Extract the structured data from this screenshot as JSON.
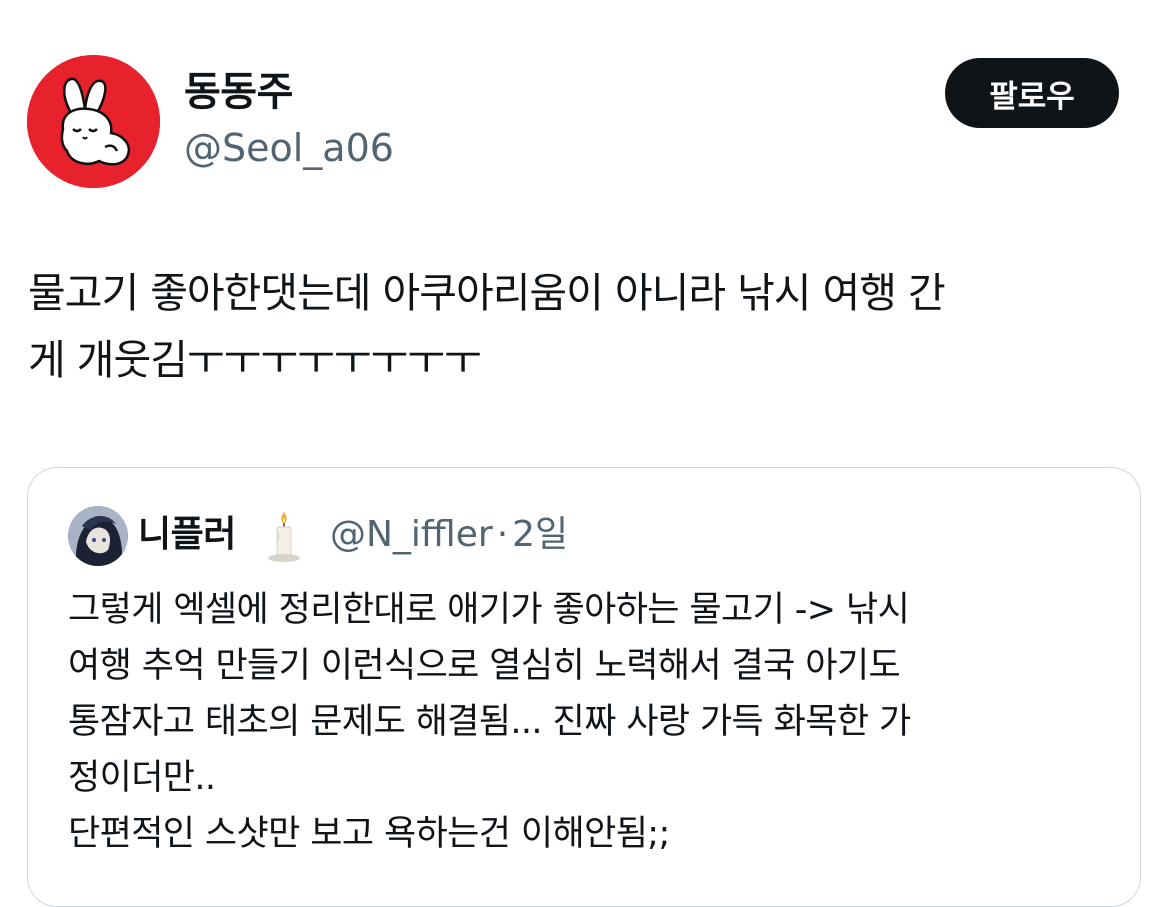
{
  "tweet": {
    "author": {
      "display_name": "동동주",
      "handle": "@Seol_a06",
      "avatar_bg": "#e8222c"
    },
    "follow_label": "팔로우",
    "text_lines": [
      "물고기 좋아한댓는데 아쿠아리움이 아니라 낚시 여행 간",
      "게 개웃김ㅜㅜㅜㅜㅜㅜㅜㅜ"
    ]
  },
  "quote": {
    "author": {
      "display_name": "니플러",
      "emoji": "candle-icon",
      "handle": "@N_iffler",
      "separator": "·",
      "time": "2일"
    },
    "text_lines": [
      "그렇게 엑셀에 정리한대로 애기가 좋아하는 물고기 -> 낚시",
      "여행 추억 만들기 이런식으로 열심히 노력해서 결국 아기도",
      "통잠자고 태초의 문제도 해결됨... 진짜 사랑 가득 화목한 가",
      "정이더만..",
      "단편적인 스샷만 보고 욕하는건 이해안됨;;"
    ]
  },
  "colors": {
    "text_primary": "#0f1419",
    "text_secondary": "#536471",
    "border": "#cfd9de",
    "button_bg": "#0f1419",
    "button_text": "#ffffff"
  }
}
